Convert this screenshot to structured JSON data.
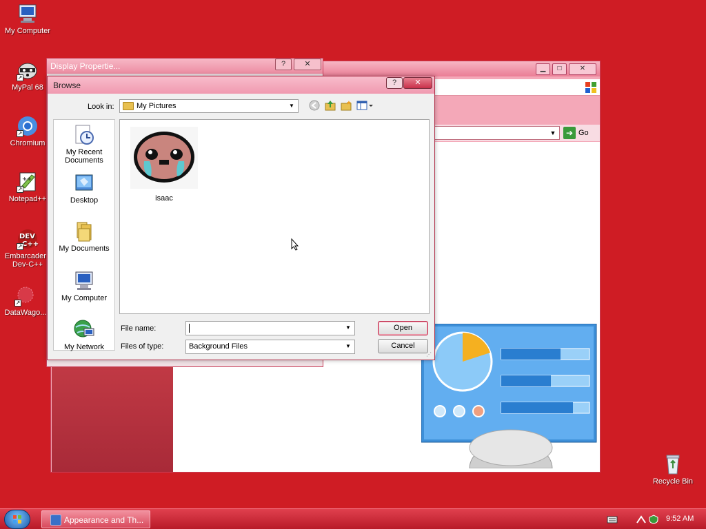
{
  "desktop": {
    "icons": [
      {
        "label": "My Computer"
      },
      {
        "label": "MyPal 68"
      },
      {
        "label": "Chromium"
      },
      {
        "label": "Notepad++"
      },
      {
        "label": "Embarcadero Dev-C++"
      },
      {
        "label": "DataWago..."
      },
      {
        "label": "Recycle Bin"
      }
    ]
  },
  "background_window": {
    "address_go_label": "Go"
  },
  "display_properties": {
    "title": "Display Propertie..."
  },
  "browse_dialog": {
    "title": "Browse",
    "look_in_label": "Look in:",
    "look_in_value": "My Pictures",
    "places": [
      {
        "label": "My Recent Documents"
      },
      {
        "label": "Desktop"
      },
      {
        "label": "My Documents"
      },
      {
        "label": "My Computer"
      },
      {
        "label": "My Network"
      }
    ],
    "files": [
      {
        "name": "isaac"
      }
    ],
    "file_name_label": "File name:",
    "file_name_value": "",
    "file_type_label": "Files of type:",
    "file_type_value": "Background Files",
    "open_label": "Open",
    "cancel_label": "Cancel"
  },
  "taskbar": {
    "task_label": "Appearance and Th...",
    "clock": "9:52 AM"
  }
}
